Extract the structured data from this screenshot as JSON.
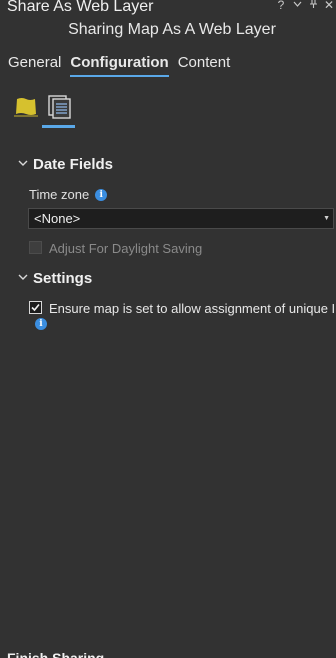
{
  "pane": {
    "title": "Share As Web Layer",
    "controls": {
      "help": "?",
      "menu": "⌄",
      "pin": "ᵼ",
      "close": "✕"
    },
    "subtitle": "Sharing Map As A Web Layer"
  },
  "tabs": [
    {
      "label": "General",
      "active": false
    },
    {
      "label": "Configuration",
      "active": true
    },
    {
      "label": "Content",
      "active": false
    }
  ],
  "subicons": {
    "items": [
      "map-icon",
      "configure-layers-icon"
    ],
    "selected": "configure-layers-icon",
    "map_color": "#d6c12e",
    "accent": "#5aa8e8"
  },
  "date_fields": {
    "heading": "Date Fields",
    "time_zone_label": "Time zone",
    "time_zone_value": "<None>",
    "daylight_label": "Adjust For Daylight Saving",
    "daylight_checked": false,
    "daylight_enabled": false
  },
  "settings": {
    "heading": "Settings",
    "unique_ids_label": "Ensure map is set to allow assignment of unique IDs",
    "unique_ids_checked": true
  },
  "footer": {
    "label": "Finish Sharing"
  },
  "colors": {
    "background": "#323232",
    "info": "#3b8ee0"
  }
}
